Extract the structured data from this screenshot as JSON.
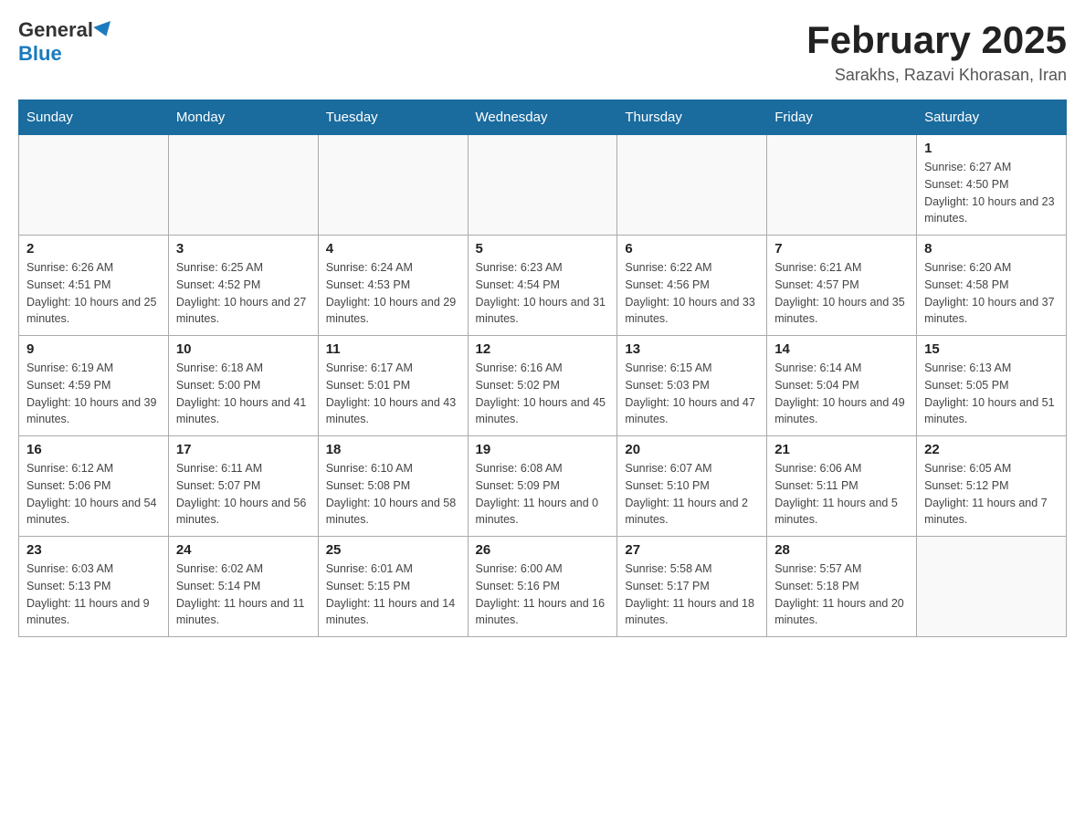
{
  "header": {
    "logo_general": "General",
    "logo_blue": "Blue",
    "month_title": "February 2025",
    "location": "Sarakhs, Razavi Khorasan, Iran"
  },
  "days_of_week": [
    "Sunday",
    "Monday",
    "Tuesday",
    "Wednesday",
    "Thursday",
    "Friday",
    "Saturday"
  ],
  "weeks": [
    [
      {
        "day": "",
        "sunrise": "",
        "sunset": "",
        "daylight": ""
      },
      {
        "day": "",
        "sunrise": "",
        "sunset": "",
        "daylight": ""
      },
      {
        "day": "",
        "sunrise": "",
        "sunset": "",
        "daylight": ""
      },
      {
        "day": "",
        "sunrise": "",
        "sunset": "",
        "daylight": ""
      },
      {
        "day": "",
        "sunrise": "",
        "sunset": "",
        "daylight": ""
      },
      {
        "day": "",
        "sunrise": "",
        "sunset": "",
        "daylight": ""
      },
      {
        "day": "1",
        "sunrise": "Sunrise: 6:27 AM",
        "sunset": "Sunset: 4:50 PM",
        "daylight": "Daylight: 10 hours and 23 minutes."
      }
    ],
    [
      {
        "day": "2",
        "sunrise": "Sunrise: 6:26 AM",
        "sunset": "Sunset: 4:51 PM",
        "daylight": "Daylight: 10 hours and 25 minutes."
      },
      {
        "day": "3",
        "sunrise": "Sunrise: 6:25 AM",
        "sunset": "Sunset: 4:52 PM",
        "daylight": "Daylight: 10 hours and 27 minutes."
      },
      {
        "day": "4",
        "sunrise": "Sunrise: 6:24 AM",
        "sunset": "Sunset: 4:53 PM",
        "daylight": "Daylight: 10 hours and 29 minutes."
      },
      {
        "day": "5",
        "sunrise": "Sunrise: 6:23 AM",
        "sunset": "Sunset: 4:54 PM",
        "daylight": "Daylight: 10 hours and 31 minutes."
      },
      {
        "day": "6",
        "sunrise": "Sunrise: 6:22 AM",
        "sunset": "Sunset: 4:56 PM",
        "daylight": "Daylight: 10 hours and 33 minutes."
      },
      {
        "day": "7",
        "sunrise": "Sunrise: 6:21 AM",
        "sunset": "Sunset: 4:57 PM",
        "daylight": "Daylight: 10 hours and 35 minutes."
      },
      {
        "day": "8",
        "sunrise": "Sunrise: 6:20 AM",
        "sunset": "Sunset: 4:58 PM",
        "daylight": "Daylight: 10 hours and 37 minutes."
      }
    ],
    [
      {
        "day": "9",
        "sunrise": "Sunrise: 6:19 AM",
        "sunset": "Sunset: 4:59 PM",
        "daylight": "Daylight: 10 hours and 39 minutes."
      },
      {
        "day": "10",
        "sunrise": "Sunrise: 6:18 AM",
        "sunset": "Sunset: 5:00 PM",
        "daylight": "Daylight: 10 hours and 41 minutes."
      },
      {
        "day": "11",
        "sunrise": "Sunrise: 6:17 AM",
        "sunset": "Sunset: 5:01 PM",
        "daylight": "Daylight: 10 hours and 43 minutes."
      },
      {
        "day": "12",
        "sunrise": "Sunrise: 6:16 AM",
        "sunset": "Sunset: 5:02 PM",
        "daylight": "Daylight: 10 hours and 45 minutes."
      },
      {
        "day": "13",
        "sunrise": "Sunrise: 6:15 AM",
        "sunset": "Sunset: 5:03 PM",
        "daylight": "Daylight: 10 hours and 47 minutes."
      },
      {
        "day": "14",
        "sunrise": "Sunrise: 6:14 AM",
        "sunset": "Sunset: 5:04 PM",
        "daylight": "Daylight: 10 hours and 49 minutes."
      },
      {
        "day": "15",
        "sunrise": "Sunrise: 6:13 AM",
        "sunset": "Sunset: 5:05 PM",
        "daylight": "Daylight: 10 hours and 51 minutes."
      }
    ],
    [
      {
        "day": "16",
        "sunrise": "Sunrise: 6:12 AM",
        "sunset": "Sunset: 5:06 PM",
        "daylight": "Daylight: 10 hours and 54 minutes."
      },
      {
        "day": "17",
        "sunrise": "Sunrise: 6:11 AM",
        "sunset": "Sunset: 5:07 PM",
        "daylight": "Daylight: 10 hours and 56 minutes."
      },
      {
        "day": "18",
        "sunrise": "Sunrise: 6:10 AM",
        "sunset": "Sunset: 5:08 PM",
        "daylight": "Daylight: 10 hours and 58 minutes."
      },
      {
        "day": "19",
        "sunrise": "Sunrise: 6:08 AM",
        "sunset": "Sunset: 5:09 PM",
        "daylight": "Daylight: 11 hours and 0 minutes."
      },
      {
        "day": "20",
        "sunrise": "Sunrise: 6:07 AM",
        "sunset": "Sunset: 5:10 PM",
        "daylight": "Daylight: 11 hours and 2 minutes."
      },
      {
        "day": "21",
        "sunrise": "Sunrise: 6:06 AM",
        "sunset": "Sunset: 5:11 PM",
        "daylight": "Daylight: 11 hours and 5 minutes."
      },
      {
        "day": "22",
        "sunrise": "Sunrise: 6:05 AM",
        "sunset": "Sunset: 5:12 PM",
        "daylight": "Daylight: 11 hours and 7 minutes."
      }
    ],
    [
      {
        "day": "23",
        "sunrise": "Sunrise: 6:03 AM",
        "sunset": "Sunset: 5:13 PM",
        "daylight": "Daylight: 11 hours and 9 minutes."
      },
      {
        "day": "24",
        "sunrise": "Sunrise: 6:02 AM",
        "sunset": "Sunset: 5:14 PM",
        "daylight": "Daylight: 11 hours and 11 minutes."
      },
      {
        "day": "25",
        "sunrise": "Sunrise: 6:01 AM",
        "sunset": "Sunset: 5:15 PM",
        "daylight": "Daylight: 11 hours and 14 minutes."
      },
      {
        "day": "26",
        "sunrise": "Sunrise: 6:00 AM",
        "sunset": "Sunset: 5:16 PM",
        "daylight": "Daylight: 11 hours and 16 minutes."
      },
      {
        "day": "27",
        "sunrise": "Sunrise: 5:58 AM",
        "sunset": "Sunset: 5:17 PM",
        "daylight": "Daylight: 11 hours and 18 minutes."
      },
      {
        "day": "28",
        "sunrise": "Sunrise: 5:57 AM",
        "sunset": "Sunset: 5:18 PM",
        "daylight": "Daylight: 11 hours and 20 minutes."
      },
      {
        "day": "",
        "sunrise": "",
        "sunset": "",
        "daylight": ""
      }
    ]
  ]
}
